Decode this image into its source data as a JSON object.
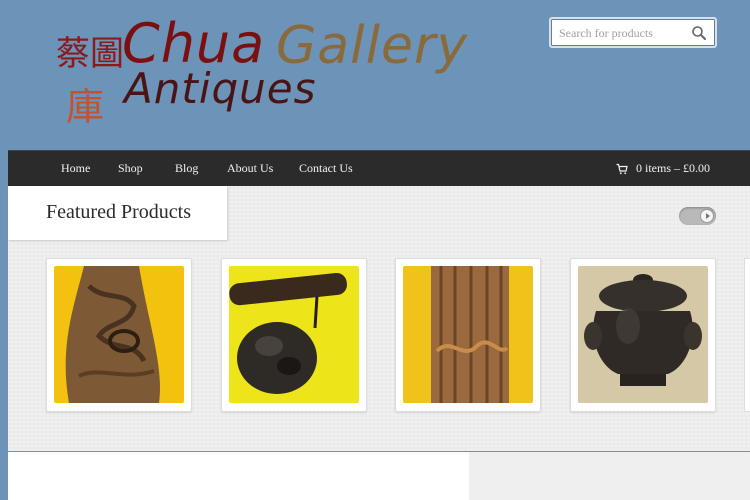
{
  "logo": {
    "cn_top": "蔡圖",
    "cn_bottom": "庫",
    "word_chua": "Chua",
    "word_gallery": "Gallery",
    "word_antiques": "Antiques"
  },
  "search": {
    "placeholder": "Search for products"
  },
  "nav": {
    "items": [
      {
        "label": "Home"
      },
      {
        "label": "Shop"
      },
      {
        "label": "Blog"
      },
      {
        "label": "About Us"
      },
      {
        "label": "Contact Us"
      }
    ],
    "cart": "0 items – £0.00"
  },
  "featured": {
    "title": "Featured Products"
  },
  "colors": {
    "page_bg": "#6c93b8",
    "nav_bg": "#2b2b2b",
    "logo_chua": "#7a1010",
    "logo_gallery": "#8a6a3a",
    "logo_antiques": "#4a1414",
    "product_bg": "#f3c20e"
  },
  "icons": {
    "search": "search-icon",
    "cart": "cart-icon",
    "play": "play-icon"
  }
}
